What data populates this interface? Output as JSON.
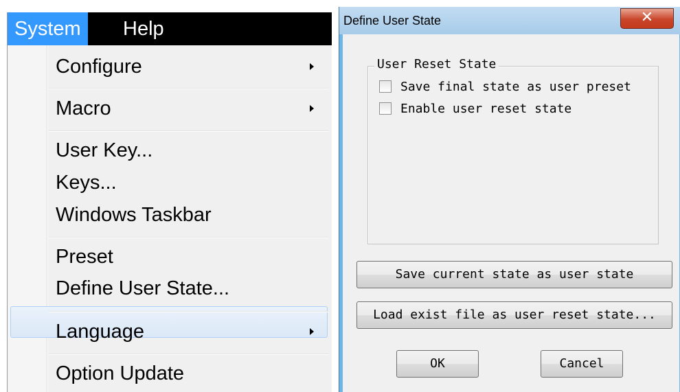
{
  "menubar": {
    "items": [
      {
        "label": "System"
      },
      {
        "label": "Help"
      }
    ]
  },
  "system_menu": {
    "items": [
      {
        "label": "Configure",
        "submenu": true
      },
      {
        "label": "Macro",
        "submenu": true
      },
      {
        "label": "User Key..."
      },
      {
        "label": "Keys..."
      },
      {
        "label": "Windows Taskbar"
      },
      {
        "label": "Preset"
      },
      {
        "label": "Define User State...",
        "highlighted": true
      },
      {
        "label": "Language",
        "submenu": true
      },
      {
        "label": "Option Update"
      }
    ]
  },
  "dialog": {
    "title": "Define User State",
    "close_icon": "close-x",
    "group": {
      "title": "User Reset State",
      "checkboxes": [
        {
          "label": "Save final state as user preset",
          "checked": false
        },
        {
          "label": "Enable user reset state",
          "checked": false
        }
      ]
    },
    "buttons": {
      "save_current": "Save current state as user state",
      "load_exist": "Load exist file as user reset state...",
      "ok": "OK",
      "cancel": "Cancel"
    }
  },
  "colors": {
    "menubar_bg": "#000000",
    "menubar_active": "#3399ff",
    "menu_bg": "#f0f0f0",
    "highlight_border": "#aecff7",
    "titlebar": "#a7cbe9",
    "close_button": "#c9452a"
  }
}
